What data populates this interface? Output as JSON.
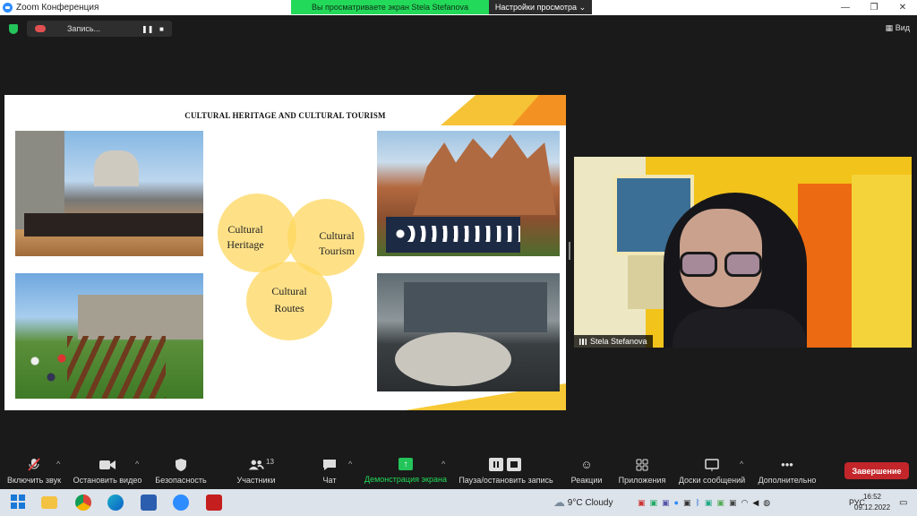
{
  "window": {
    "title": "Zoom Конференция",
    "share_notice": "Вы просматриваете экран Stela Stefanova",
    "view_options": "Настройки просмотра",
    "minimize": "—",
    "restore": "❐",
    "close": "✕"
  },
  "topbar": {
    "recording_label": "Запись...",
    "pause_glyph": "❚❚",
    "stop_glyph": "■",
    "view_label": "Вид"
  },
  "slide": {
    "title": "CULTURAL HERITAGE AND CULTURAL TOURISM",
    "venn": [
      {
        "line1": "Cultural",
        "line2": "Heritage"
      },
      {
        "line1": "Cultural",
        "line2": "Tourism"
      },
      {
        "line1": "Cultural",
        "line2": "Routes"
      }
    ]
  },
  "participant": {
    "name": "Stela Stefanova"
  },
  "toolbar": {
    "mute": "Включить звук",
    "video": "Остановить видео",
    "security": "Безопасность",
    "participants": "Участники",
    "participants_count": "13",
    "chat": "Чат",
    "share": "Демонстрация экрана",
    "pause_record": "Пауза/остановить запись",
    "reactions": "Реакции",
    "apps": "Приложения",
    "whiteboards": "Доски сообщений",
    "more": "Дополнительно",
    "end": "Завершение",
    "caret": "^"
  },
  "taskbar": {
    "weather_temp": "9°C",
    "weather_text": "Cloudy",
    "language": "РУС",
    "time": "16:52",
    "date": "09.12.2022"
  },
  "colors": {
    "share_green": "#23d959",
    "end_red": "#c3262a",
    "venn_yellow": "#fdd75f"
  }
}
